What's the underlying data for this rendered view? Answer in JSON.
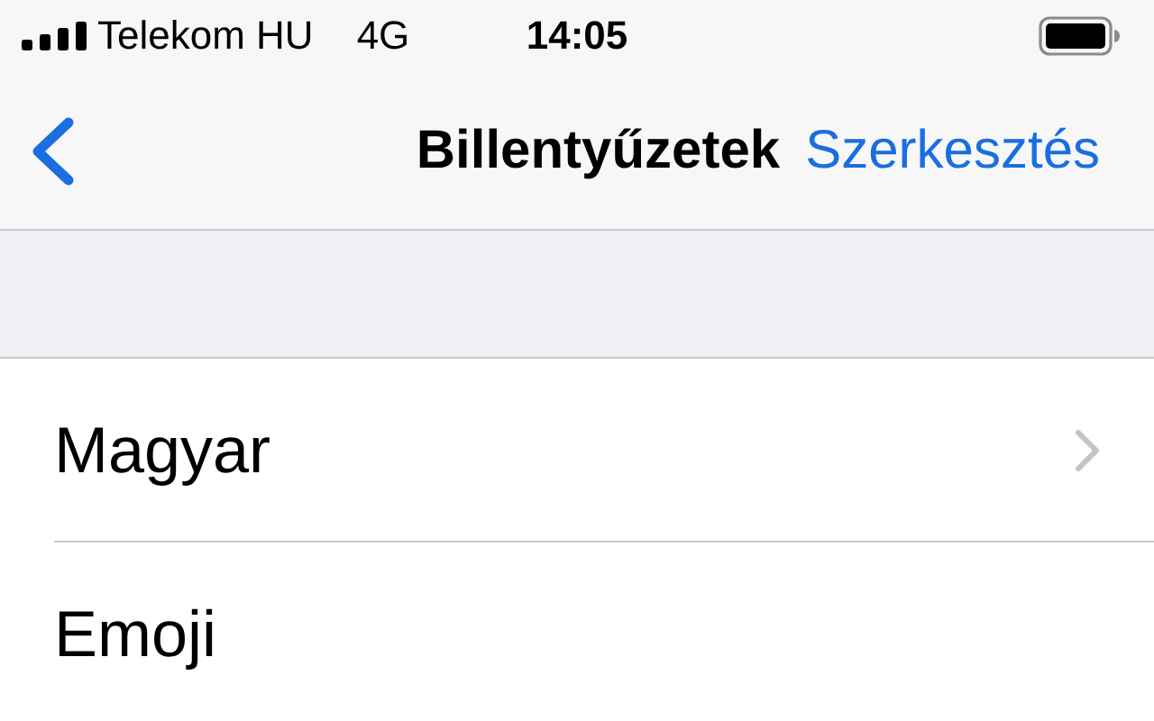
{
  "status_bar": {
    "carrier": "Telekom HU",
    "network": "4G",
    "time": "14:05"
  },
  "nav_bar": {
    "title": "Billentyűzetek",
    "action": "Szerkesztés"
  },
  "rows": [
    {
      "label": "Magyar",
      "disclosure": true
    },
    {
      "label": "Emoji",
      "disclosure": false
    }
  ]
}
